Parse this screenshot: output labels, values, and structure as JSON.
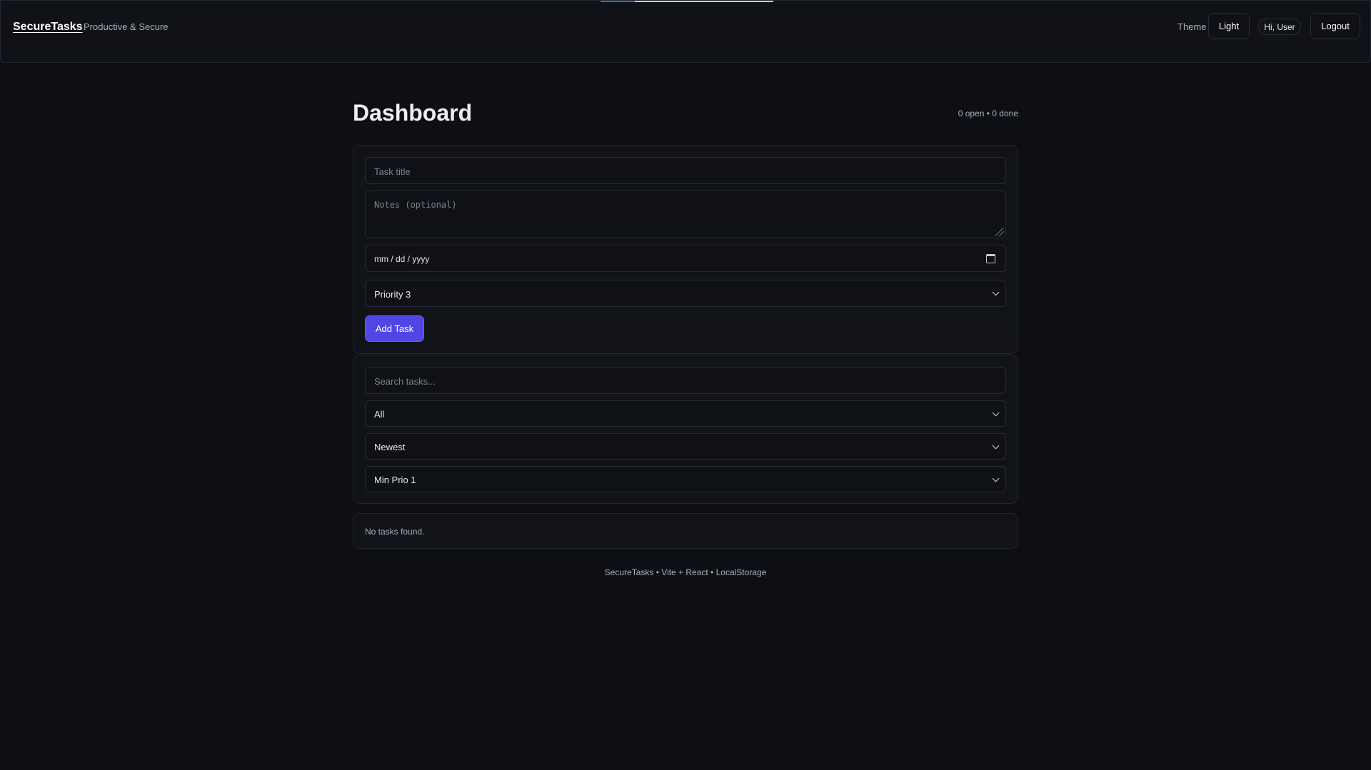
{
  "header": {
    "brand": "SecureTasks",
    "tagline": "Productive & Secure",
    "theme_label": "Theme",
    "theme_button": "Light",
    "user_greeting": "Hi, User",
    "logout_label": "Logout"
  },
  "dashboard": {
    "title": "Dashboard",
    "counts": "0 open • 0 done"
  },
  "form": {
    "title_placeholder": "Task title",
    "notes_placeholder": "Notes (optional)",
    "date_placeholder": "mm / dd / yyyy",
    "priority_value": "Priority 3",
    "add_button": "Add Task"
  },
  "filters": {
    "search_placeholder": "Search tasks...",
    "status_value": "All",
    "sort_value": "Newest",
    "min_priority_value": "Min Prio 1"
  },
  "task_list": {
    "empty_message": "No tasks found."
  },
  "footer": {
    "text": "SecureTasks • Vite + React • LocalStorage"
  },
  "colors": {
    "background": "#0d0f14",
    "card": "#111318",
    "accent": "#5046e5"
  },
  "icons": {
    "date": "calendar-icon",
    "select": "chevron-down-icon"
  }
}
